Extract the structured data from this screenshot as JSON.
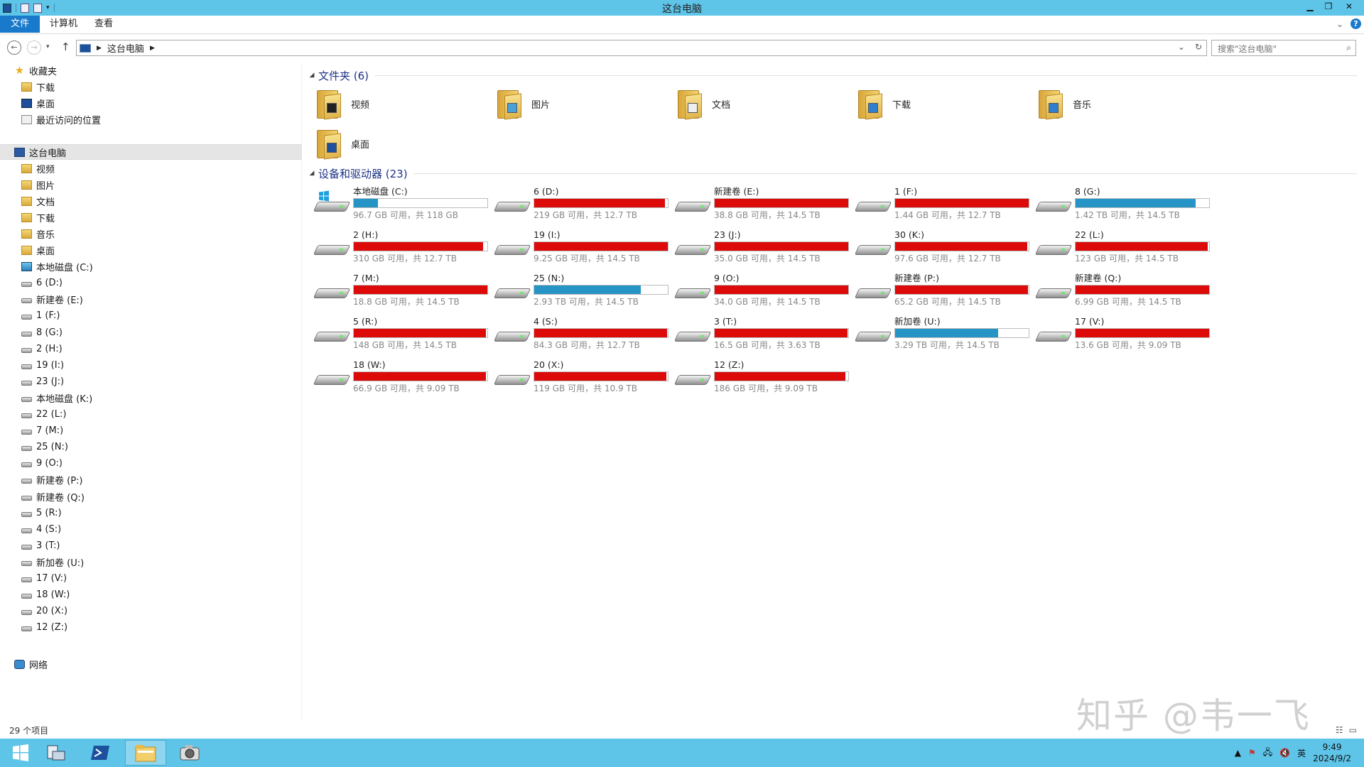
{
  "window": {
    "title": "这台电脑"
  },
  "ribbon": {
    "tabs": [
      "文件",
      "计算机",
      "查看"
    ]
  },
  "nav": {
    "path": "这台电脑",
    "search_placeholder": "搜索\"这台电脑\""
  },
  "sidebar": {
    "favorites": {
      "label": "收藏夹",
      "items": [
        "下载",
        "桌面",
        "最近访问的位置"
      ]
    },
    "thispc": {
      "label": "这台电脑",
      "items": [
        "视频",
        "图片",
        "文档",
        "下载",
        "音乐",
        "桌面",
        "本地磁盘 (C:)",
        "6 (D:)",
        "新建卷 (E:)",
        "1 (F:)",
        "8 (G:)",
        "2 (H:)",
        "19 (I:)",
        "23 (J:)",
        "本地磁盘 (K:)",
        "22 (L:)",
        "7 (M:)",
        "25 (N:)",
        "9 (O:)",
        "新建卷 (P:)",
        "新建卷 (Q:)",
        "5 (R:)",
        "4 (S:)",
        "3 (T:)",
        "新加卷 (U:)",
        "17 (V:)",
        "18 (W:)",
        "20 (X:)",
        "12 (Z:)"
      ]
    },
    "network": {
      "label": "网络"
    }
  },
  "folders_group": {
    "label": "文件夹 (6)",
    "items": [
      "视频",
      "图片",
      "文档",
      "下载",
      "音乐",
      "桌面"
    ]
  },
  "drives_group": {
    "label": "设备和驱动器 (23)",
    "items": [
      {
        "name": "本地磁盘 (C:)",
        "size": "96.7 GB 可用，共 118 GB",
        "used": 0.18,
        "color": "#2694c4",
        "sys": true
      },
      {
        "name": "6 (D:)",
        "size": "219 GB 可用，共 12.7 TB",
        "used": 0.98,
        "color": "#dd0a0a"
      },
      {
        "name": "新建卷 (E:)",
        "size": "38.8 GB 可用，共 14.5 TB",
        "used": 0.998,
        "color": "#dd0a0a"
      },
      {
        "name": "1 (F:)",
        "size": "1.44 GB 可用，共 12.7 TB",
        "used": 0.999,
        "color": "#dd0a0a"
      },
      {
        "name": "8 (G:)",
        "size": "1.42 TB 可用，共 14.5 TB",
        "used": 0.9,
        "color": "#2694c4"
      },
      {
        "name": "2 (H:)",
        "size": "310 GB 可用，共 12.7 TB",
        "used": 0.97,
        "color": "#dd0a0a"
      },
      {
        "name": "19 (I:)",
        "size": "9.25 GB 可用，共 14.5 TB",
        "used": 0.999,
        "color": "#dd0a0a"
      },
      {
        "name": "23 (J:)",
        "size": "35.0 GB 可用，共 14.5 TB",
        "used": 0.998,
        "color": "#dd0a0a"
      },
      {
        "name": "30 (K:)",
        "size": "97.6 GB 可用，共 12.7 TB",
        "used": 0.99,
        "color": "#dd0a0a"
      },
      {
        "name": "22 (L:)",
        "size": "123 GB 可用，共 14.5 TB",
        "used": 0.99,
        "color": "#dd0a0a"
      },
      {
        "name": "7 (M:)",
        "size": "18.8 GB 可用，共 14.5 TB",
        "used": 0.999,
        "color": "#dd0a0a"
      },
      {
        "name": "25 (N:)",
        "size": "2.93 TB 可用，共 14.5 TB",
        "used": 0.8,
        "color": "#2694c4"
      },
      {
        "name": "9 (O:)",
        "size": "34.0 GB 可用，共 14.5 TB",
        "used": 0.998,
        "color": "#dd0a0a"
      },
      {
        "name": "新建卷 (P:)",
        "size": "65.2 GB 可用，共 14.5 TB",
        "used": 0.995,
        "color": "#dd0a0a"
      },
      {
        "name": "新建卷 (Q:)",
        "size": "6.99 GB 可用，共 14.5 TB",
        "used": 0.999,
        "color": "#dd0a0a"
      },
      {
        "name": "5 (R:)",
        "size": "148 GB 可用，共 14.5 TB",
        "used": 0.99,
        "color": "#dd0a0a"
      },
      {
        "name": "4 (S:)",
        "size": "84.3 GB 可用，共 12.7 TB",
        "used": 0.993,
        "color": "#dd0a0a"
      },
      {
        "name": "3 (T:)",
        "size": "16.5 GB 可用，共 3.63 TB",
        "used": 0.995,
        "color": "#dd0a0a"
      },
      {
        "name": "新加卷 (U:)",
        "size": "3.29 TB 可用，共 14.5 TB",
        "used": 0.77,
        "color": "#2694c4"
      },
      {
        "name": "17 (V:)",
        "size": "13.6 GB 可用，共 9.09 TB",
        "used": 0.998,
        "color": "#dd0a0a"
      },
      {
        "name": "18 (W:)",
        "size": "66.9 GB 可用，共 9.09 TB",
        "used": 0.99,
        "color": "#dd0a0a"
      },
      {
        "name": "20 (X:)",
        "size": "119 GB 可用，共 10.9 TB",
        "used": 0.99,
        "color": "#dd0a0a"
      },
      {
        "name": "12 (Z:)",
        "size": "186 GB 可用，共 9.09 TB",
        "used": 0.98,
        "color": "#dd0a0a"
      }
    ]
  },
  "status": {
    "count": "29 个项目"
  },
  "watermark": "知乎 @韦一飞",
  "tray": {
    "time": "9:49",
    "date": "2024/9/2",
    "ime": "英"
  }
}
